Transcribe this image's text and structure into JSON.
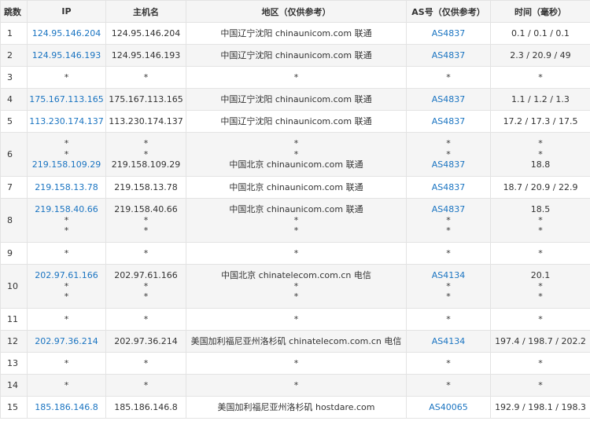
{
  "headers": [
    "跳数",
    "IP",
    "主机名",
    "地区（仅供参考）",
    "AS号（仅供参考）",
    "时间（毫秒）"
  ],
  "rows": [
    {
      "hop": "1",
      "ip": [
        "124.95.146.204"
      ],
      "host": [
        "124.95.146.204"
      ],
      "region": [
        "中国辽宁沈阳 chinaunicom.com 联通"
      ],
      "as": [
        "AS4837"
      ],
      "time": [
        "0.1 / 0.1 / 0.1"
      ]
    },
    {
      "hop": "2",
      "ip": [
        "124.95.146.193"
      ],
      "host": [
        "124.95.146.193"
      ],
      "region": [
        "中国辽宁沈阳 chinaunicom.com 联通"
      ],
      "as": [
        "AS4837"
      ],
      "time": [
        "2.3 / 20.9 / 49"
      ]
    },
    {
      "hop": "3",
      "ip": [
        "*"
      ],
      "host": [
        "*"
      ],
      "region": [
        "*"
      ],
      "as": [
        "*"
      ],
      "time": [
        "*"
      ]
    },
    {
      "hop": "4",
      "ip": [
        "175.167.113.165"
      ],
      "host": [
        "175.167.113.165"
      ],
      "region": [
        "中国辽宁沈阳 chinaunicom.com 联通"
      ],
      "as": [
        "AS4837"
      ],
      "time": [
        "1.1 / 1.2 / 1.3"
      ]
    },
    {
      "hop": "5",
      "ip": [
        "113.230.174.137"
      ],
      "host": [
        "113.230.174.137"
      ],
      "region": [
        "中国辽宁沈阳 chinaunicom.com 联通"
      ],
      "as": [
        "AS4837"
      ],
      "time": [
        "17.2 / 17.3 / 17.5"
      ]
    },
    {
      "hop": "6",
      "ip": [
        "*",
        "*",
        "219.158.109.29"
      ],
      "host": [
        "*",
        "*",
        "219.158.109.29"
      ],
      "region": [
        "*",
        "*",
        "中国北京 chinaunicom.com 联通"
      ],
      "as": [
        "*",
        "*",
        "AS4837"
      ],
      "time": [
        "*",
        "*",
        "18.8"
      ]
    },
    {
      "hop": "7",
      "ip": [
        "219.158.13.78"
      ],
      "host": [
        "219.158.13.78"
      ],
      "region": [
        "中国北京 chinaunicom.com 联通"
      ],
      "as": [
        "AS4837"
      ],
      "time": [
        "18.7 / 20.9 / 22.9"
      ]
    },
    {
      "hop": "8",
      "ip": [
        "219.158.40.66",
        "*",
        "*"
      ],
      "host": [
        "219.158.40.66",
        "*",
        "*"
      ],
      "region": [
        "中国北京 chinaunicom.com 联通",
        "*",
        "*"
      ],
      "as": [
        "AS4837",
        "*",
        "*"
      ],
      "time": [
        "18.5",
        "*",
        "*"
      ]
    },
    {
      "hop": "9",
      "ip": [
        "*"
      ],
      "host": [
        "*"
      ],
      "region": [
        "*"
      ],
      "as": [
        "*"
      ],
      "time": [
        "*"
      ]
    },
    {
      "hop": "10",
      "ip": [
        "202.97.61.166",
        "*",
        "*"
      ],
      "host": [
        "202.97.61.166",
        "*",
        "*"
      ],
      "region": [
        "中国北京 chinatelecom.com.cn 电信",
        "*",
        "*"
      ],
      "as": [
        "AS4134",
        "*",
        "*"
      ],
      "time": [
        "20.1",
        "*",
        "*"
      ]
    },
    {
      "hop": "11",
      "ip": [
        "*"
      ],
      "host": [
        "*"
      ],
      "region": [
        "*"
      ],
      "as": [
        "*"
      ],
      "time": [
        "*"
      ]
    },
    {
      "hop": "12",
      "ip": [
        "202.97.36.214"
      ],
      "host": [
        "202.97.36.214"
      ],
      "region": [
        "美国加利福尼亚州洛杉矶 chinatelecom.com.cn 电信"
      ],
      "as": [
        "AS4134"
      ],
      "time": [
        "197.4 / 198.7 / 202.2"
      ]
    },
    {
      "hop": "13",
      "ip": [
        "*"
      ],
      "host": [
        "*"
      ],
      "region": [
        "*"
      ],
      "as": [
        "*"
      ],
      "time": [
        "*"
      ]
    },
    {
      "hop": "14",
      "ip": [
        "*"
      ],
      "host": [
        "*"
      ],
      "region": [
        "*"
      ],
      "as": [
        "*"
      ],
      "time": [
        "*"
      ]
    },
    {
      "hop": "15",
      "ip": [
        "185.186.146.8"
      ],
      "host": [
        "185.186.146.8"
      ],
      "region": [
        "美国加利福尼亚州洛杉矶 hostdare.com"
      ],
      "as": [
        "AS40065"
      ],
      "time": [
        "192.9 / 198.1 / 198.3"
      ]
    }
  ],
  "colors": {
    "link": "#1a74c1",
    "stripe": "#f5f5f5",
    "border": "#e3e3e3"
  }
}
